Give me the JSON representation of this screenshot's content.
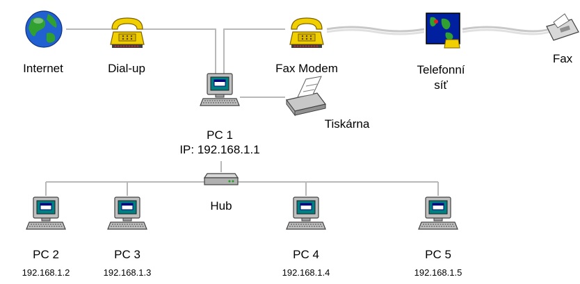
{
  "nodes": {
    "internet": {
      "label": "Internet"
    },
    "dialup": {
      "label": "Dial-up"
    },
    "faxmodem": {
      "label": "Fax Modem"
    },
    "telefonni_sit": {
      "label_line1": "Telefonní",
      "label_line2": "síť"
    },
    "fax": {
      "label": "Fax"
    },
    "pc1": {
      "label": "PC 1",
      "ip": "IP: 192.168.1.1"
    },
    "tiskarna": {
      "label": "Tiskárna"
    },
    "hub": {
      "label": "Hub"
    },
    "pc2": {
      "label": "PC 2",
      "ip": "192.168.1.2"
    },
    "pc3": {
      "label": "PC 3",
      "ip": "192.168.1.3"
    },
    "pc4": {
      "label": "PC 4",
      "ip": "192.168.1.4"
    },
    "pc5": {
      "label": "PC 5",
      "ip": "192.168.1.5"
    }
  },
  "colors": {
    "cable": "#b8b8b8",
    "phone_line": "#c8c8c8",
    "monitor_body": "#c0c0c0",
    "monitor_screen": "#008080",
    "phone_yellow": "#f0d000",
    "globe_blue": "#2060d0",
    "globe_green": "#30a030"
  },
  "icons": [
    "globe-icon",
    "phone-icon",
    "computer-icon",
    "printer-icon",
    "hub-icon",
    "map-icon",
    "fax-icon"
  ]
}
